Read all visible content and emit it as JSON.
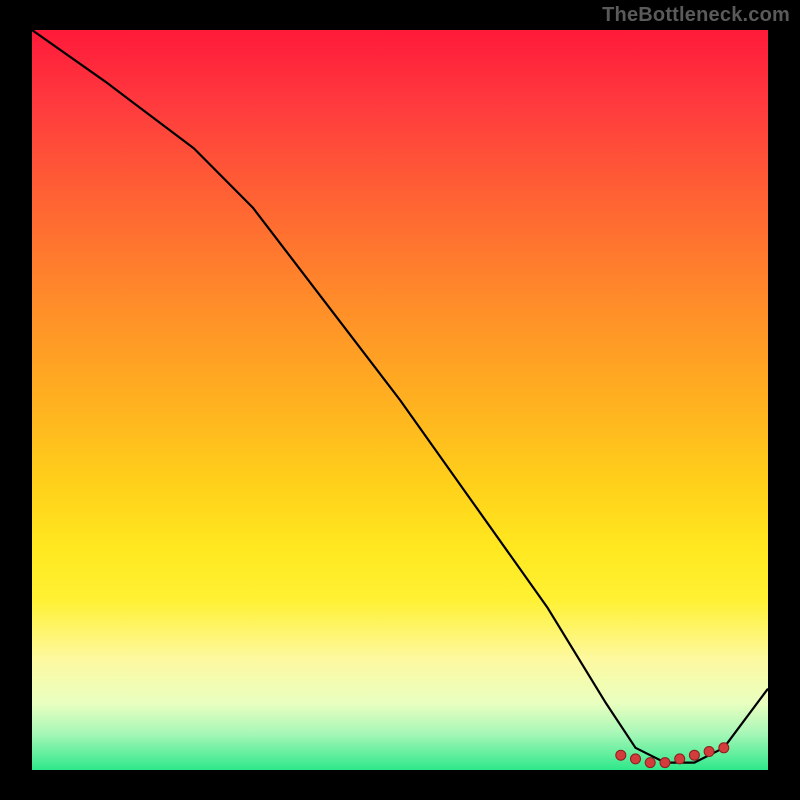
{
  "attribution": "TheBottleneck.com",
  "colors": {
    "frame": "#000000",
    "attribution_text": "#5a5a5a",
    "line": "#000000",
    "marker_fill": "#d23c3c",
    "marker_stroke": "#8e1e1e",
    "gradient_stops": [
      {
        "offset": 0,
        "color": "#ff1a3a"
      },
      {
        "offset": 10,
        "color": "#ff3a3e"
      },
      {
        "offset": 22,
        "color": "#ff6034"
      },
      {
        "offset": 36,
        "color": "#ff8a2a"
      },
      {
        "offset": 50,
        "color": "#ffb020"
      },
      {
        "offset": 62,
        "color": "#ffd21a"
      },
      {
        "offset": 70,
        "color": "#ffe820"
      },
      {
        "offset": 77,
        "color": "#fff133"
      },
      {
        "offset": 85,
        "color": "#fdf9a0"
      },
      {
        "offset": 91,
        "color": "#e9ffc0"
      },
      {
        "offset": 95,
        "color": "#a8f7b8"
      },
      {
        "offset": 100,
        "color": "#2ee88a"
      }
    ]
  },
  "chart_data": {
    "type": "line",
    "title": "",
    "xlabel": "",
    "ylabel": "",
    "xlim": [
      0,
      100
    ],
    "ylim": [
      0,
      100
    ],
    "series": [
      {
        "name": "bottleneck-curve",
        "x": [
          0,
          10,
          22,
          30,
          40,
          50,
          60,
          70,
          78,
          82,
          86,
          90,
          94,
          100
        ],
        "y": [
          100,
          93,
          84,
          76,
          63,
          50,
          36,
          22,
          9,
          3,
          1,
          1,
          3,
          11
        ]
      }
    ],
    "markers": {
      "name": "optimal-range",
      "x": [
        80,
        82,
        84,
        86,
        88,
        90,
        92,
        94
      ],
      "y": [
        2,
        1.5,
        1,
        1,
        1.5,
        2,
        2.5,
        3
      ]
    }
  }
}
